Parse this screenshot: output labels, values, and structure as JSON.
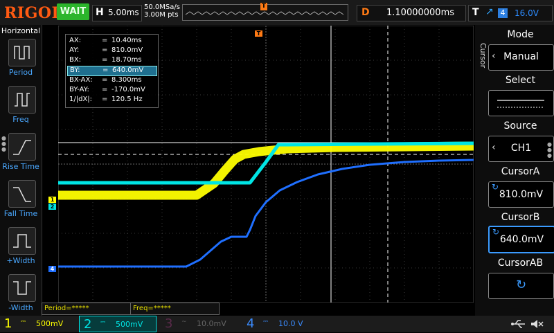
{
  "top": {
    "logo": "RIGOL",
    "status": "WAIT",
    "timebase_label": "H",
    "timebase": "5.00ms",
    "sample_rate": "50.0MSa/s",
    "mem_depth": "3.00M pts",
    "trigger_pos_marker": "T",
    "delay_label": "D",
    "delay": "1.10000000ms",
    "trigger_label": "T",
    "trigger_edge": "↗",
    "trigger_source": "4",
    "trigger_level": "16.0V"
  },
  "left_panel": {
    "title": "Horizontal",
    "buttons": [
      {
        "label": "Period",
        "icon": "period-icon"
      },
      {
        "label": "Freq",
        "icon": "freq-icon"
      },
      {
        "label": "Rise Time",
        "icon": "rise-time-icon"
      },
      {
        "label": "Fall Time",
        "icon": "fall-time-icon"
      },
      {
        "label": "+Width",
        "icon": "pos-width-icon"
      },
      {
        "label": "-Width",
        "icon": "neg-width-icon"
      }
    ]
  },
  "cursor_readout": {
    "rows": [
      {
        "key": "AX:",
        "value": "10.40ms"
      },
      {
        "key": "AY:",
        "value": "810.0mV"
      },
      {
        "key": "BX:",
        "value": "18.70ms"
      },
      {
        "key": "BY:",
        "value": "640.0mV"
      },
      {
        "key": "BX-AX:",
        "value": "8.300ms"
      },
      {
        "key": "BY-AY:",
        "value": "-170.0mV"
      },
      {
        "key": "1/|dX|:",
        "value": "120.5 Hz"
      }
    ],
    "eq": "=",
    "selected_index": 3
  },
  "channel_markers": {
    "ch1": "1",
    "ch2": "2",
    "ch4": "4",
    "trig_level": "T"
  },
  "measurements": {
    "period": "Period=*****",
    "freq": "Freq=*****"
  },
  "channels": [
    {
      "num": "1",
      "scale": "500mV",
      "color": "#ffff00",
      "active": true
    },
    {
      "num": "2",
      "scale": "500mV",
      "color": "#00e5e5",
      "active": true
    },
    {
      "num": "3",
      "scale": "10.0mV",
      "color": "#c8008c",
      "active": false
    },
    {
      "num": "4",
      "scale": "10.0 V",
      "color": "#1f6fff",
      "active": true
    }
  ],
  "coupling_symbol": "⎓",
  "right_panel": {
    "vertical_title": "Cursor",
    "mode_label": "Mode",
    "mode_value": "Manual",
    "select_label": "Select",
    "source_label": "Source",
    "source_value": "CH1",
    "cursor_a_label": "CursorA",
    "cursor_a_value": "810.0mV",
    "cursor_b_label": "CursorB",
    "cursor_b_value": "640.0mV",
    "cursor_ab_label": "CursorAB"
  },
  "colors": {
    "ch1": "#ffff00",
    "ch2": "#00e5e5",
    "ch4": "#1f6fff",
    "trigger": "#ff7a14",
    "status": "#2cb52c",
    "selection": "#3b9bff"
  }
}
